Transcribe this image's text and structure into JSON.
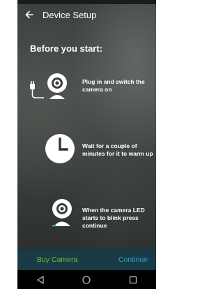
{
  "topbar": {
    "title": "Device Setup",
    "back_icon": "back-arrow-icon"
  },
  "heading": "Before you start:",
  "steps": [
    {
      "icon": "camera-plug-icon",
      "text": "Plug in and switch the camera on"
    },
    {
      "icon": "clock-icon",
      "text": "Wait for a couple of minutes for it to warm up"
    },
    {
      "icon": "camera-led-icon",
      "text": "When the camera LED starts to blink press continue"
    }
  ],
  "actions": {
    "buy_label": "Buy Camera",
    "continue_label": "Continue"
  },
  "navbar": {
    "icons": [
      "back-triangle-icon",
      "home-circle-icon",
      "recents-square-icon"
    ]
  },
  "colors": {
    "buy_button": "#6fbf3c",
    "continue_button": "#2aa5c9",
    "bottom_bar": "#1a3a46"
  }
}
